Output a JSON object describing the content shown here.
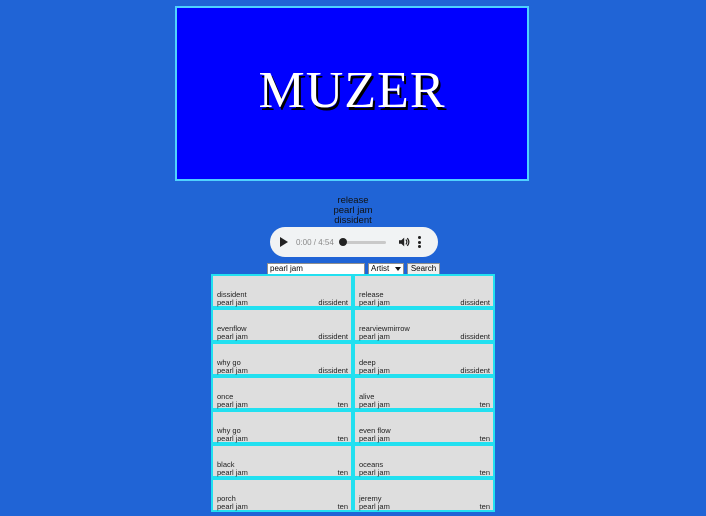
{
  "banner": {
    "title": "MUZER"
  },
  "now_playing": {
    "title": "release",
    "artist": "pearl jam",
    "album": "dissident"
  },
  "player": {
    "time": "0:00 / 4:54",
    "progress_fraction": 0.0
  },
  "search": {
    "query": "pearl jam",
    "filter_selected": "Artist",
    "button_label": "Search"
  },
  "results": [
    {
      "title": "dissident",
      "artist": "pearl jam",
      "album": "dissident"
    },
    {
      "title": "release",
      "artist": "pearl jam",
      "album": "dissident"
    },
    {
      "title": "evenflow",
      "artist": "pearl jam",
      "album": "dissident"
    },
    {
      "title": "rearviewmirrow",
      "artist": "pearl jam",
      "album": "dissident"
    },
    {
      "title": "why go",
      "artist": "pearl jam",
      "album": "dissident"
    },
    {
      "title": "deep",
      "artist": "pearl jam",
      "album": "dissident"
    },
    {
      "title": "once",
      "artist": "pearl jam",
      "album": "ten"
    },
    {
      "title": "alive",
      "artist": "pearl jam",
      "album": "ten"
    },
    {
      "title": "why go",
      "artist": "pearl jam",
      "album": "ten"
    },
    {
      "title": "even flow",
      "artist": "pearl jam",
      "album": "ten"
    },
    {
      "title": "black",
      "artist": "pearl jam",
      "album": "ten"
    },
    {
      "title": "oceans",
      "artist": "pearl jam",
      "album": "ten"
    },
    {
      "title": "porch",
      "artist": "pearl jam",
      "album": "ten"
    },
    {
      "title": "jeremy",
      "artist": "pearl jam",
      "album": "ten"
    }
  ]
}
